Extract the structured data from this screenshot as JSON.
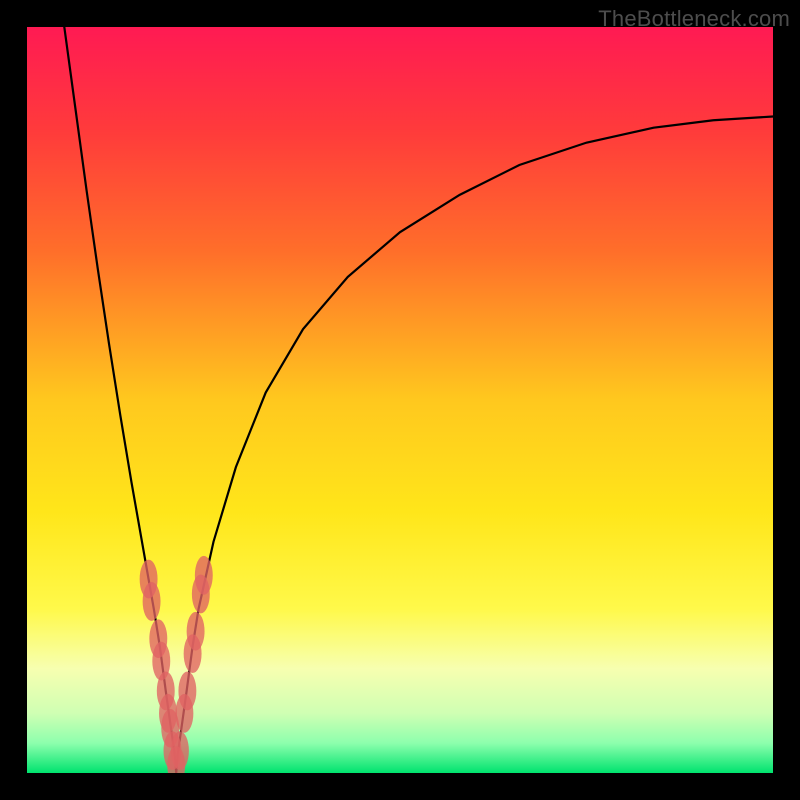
{
  "watermark": "TheBottleneck.com",
  "chart_data": {
    "type": "line",
    "title": "",
    "xlabel": "",
    "ylabel": "",
    "xlim": [
      0,
      100
    ],
    "ylim": [
      0,
      100
    ],
    "background_gradient": {
      "stops": [
        {
          "offset": 0.0,
          "color": "#ff1a53"
        },
        {
          "offset": 0.14,
          "color": "#ff3b3b"
        },
        {
          "offset": 0.3,
          "color": "#ff6e2a"
        },
        {
          "offset": 0.5,
          "color": "#ffc81e"
        },
        {
          "offset": 0.65,
          "color": "#ffe61a"
        },
        {
          "offset": 0.78,
          "color": "#fff94a"
        },
        {
          "offset": 0.86,
          "color": "#f7ffb0"
        },
        {
          "offset": 0.92,
          "color": "#cfffb3"
        },
        {
          "offset": 0.96,
          "color": "#8dffad"
        },
        {
          "offset": 1.0,
          "color": "#00e36e"
        }
      ]
    },
    "series": [
      {
        "name": "bottleneck-curve",
        "color": "#000000",
        "x": [
          5.0,
          6.5,
          8.0,
          9.5,
          11.0,
          12.5,
          14.0,
          15.5,
          17.0,
          17.8,
          18.6,
          19.3,
          19.8,
          20.0,
          20.2,
          20.7,
          21.4,
          22.2,
          23.0,
          25.0,
          28.0,
          32.0,
          37.0,
          43.0,
          50.0,
          58.0,
          66.0,
          75.0,
          84.0,
          92.0,
          100.0
        ],
        "y": [
          100.0,
          89.0,
          78.0,
          67.5,
          57.5,
          48.0,
          39.0,
          30.5,
          22.0,
          17.0,
          11.0,
          6.0,
          2.5,
          0.0,
          2.5,
          6.0,
          11.0,
          17.0,
          22.0,
          31.0,
          41.0,
          51.0,
          59.5,
          66.5,
          72.5,
          77.5,
          81.5,
          84.5,
          86.5,
          87.5,
          88.0
        ]
      }
    ],
    "markers": {
      "name": "highlighted-points",
      "color": "#e06363",
      "rx": 1.2,
      "ry": 2.6,
      "points": [
        {
          "x": 16.3,
          "y": 26.0
        },
        {
          "x": 16.7,
          "y": 23.0
        },
        {
          "x": 17.6,
          "y": 18.0
        },
        {
          "x": 18.0,
          "y": 15.0
        },
        {
          "x": 18.6,
          "y": 11.0
        },
        {
          "x": 18.9,
          "y": 8.0
        },
        {
          "x": 19.2,
          "y": 6.0
        },
        {
          "x": 19.5,
          "y": 3.0
        },
        {
          "x": 20.0,
          "y": 1.0
        },
        {
          "x": 20.5,
          "y": 3.0
        },
        {
          "x": 21.1,
          "y": 8.0
        },
        {
          "x": 21.5,
          "y": 11.0
        },
        {
          "x": 22.2,
          "y": 16.0
        },
        {
          "x": 22.6,
          "y": 19.0
        },
        {
          "x": 23.3,
          "y": 24.0
        },
        {
          "x": 23.7,
          "y": 26.5
        }
      ]
    }
  }
}
